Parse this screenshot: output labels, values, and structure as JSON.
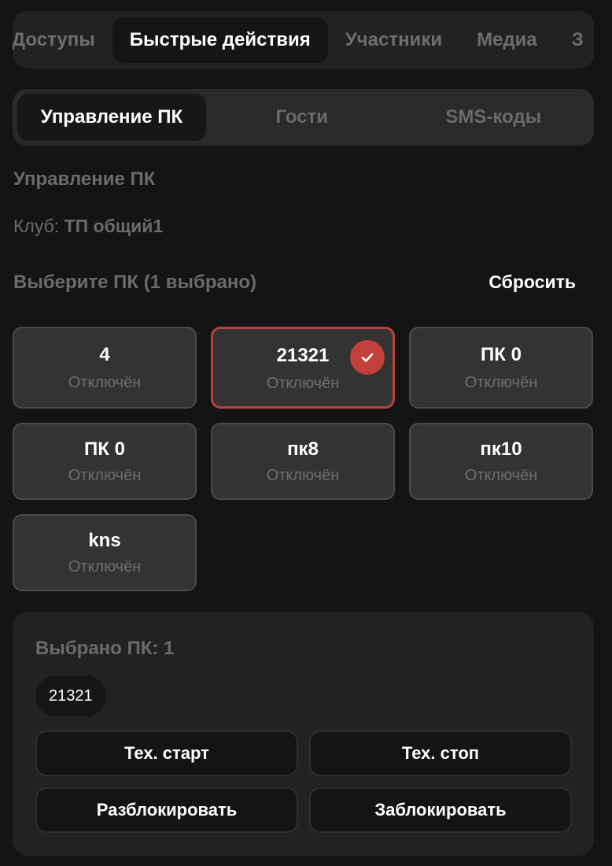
{
  "top_tabs": [
    "Доступы",
    "Быстрые действия",
    "Участники",
    "Медиа",
    "З"
  ],
  "active_top_tab": "Быстрые действия",
  "sub_tabs": [
    "Управление ПК",
    "Гости",
    "SMS-коды"
  ],
  "section_title": "Управление ПК",
  "club": {
    "label": "Клуб:",
    "name": "ТП общий1"
  },
  "selection": {
    "title": "Выберите ПК (1 выбрано)",
    "reset_label": "Сбросить"
  },
  "pcs": [
    {
      "name": "4",
      "status": "Отключён",
      "selected": false
    },
    {
      "name": "21321",
      "status": "Отключён",
      "selected": true
    },
    {
      "name": "ПК 0",
      "status": "Отключён",
      "selected": false
    },
    {
      "name": "ПК 0",
      "status": "Отключён",
      "selected": false
    },
    {
      "name": "пк8",
      "status": "Отключён",
      "selected": false
    },
    {
      "name": "пк10",
      "status": "Отключён",
      "selected": false
    },
    {
      "name": "kns",
      "status": "Отключён",
      "selected": false
    }
  ],
  "panel": {
    "title": "Выбрано ПК: 1",
    "chips": [
      "21321"
    ],
    "actions": {
      "tech_start": "Тех. старт",
      "tech_stop": "Тех. стоп",
      "unlock": "Разблокировать",
      "lock": "Заблокировать"
    }
  },
  "colors": {
    "accent": "#c2403c",
    "background": "#141414",
    "card": "#333333"
  },
  "icons": {
    "selected_check": "check-icon"
  }
}
